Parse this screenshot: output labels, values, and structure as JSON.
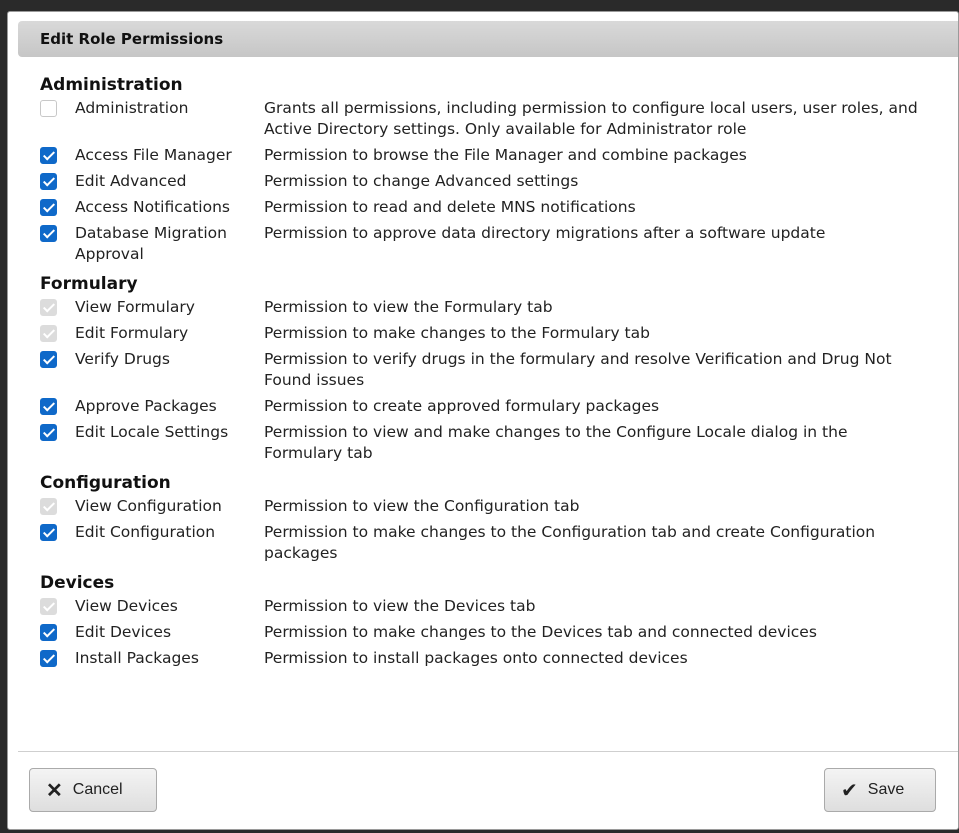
{
  "dialog": {
    "title": "Edit Role Permissions"
  },
  "sections": [
    {
      "title": "Administration",
      "items": [
        {
          "name": "Administration",
          "desc": "Grants all permissions, including permission to configure local users, user roles, and Active Directory settings. Only available for Administrator role",
          "state": "empty"
        },
        {
          "name": "Access File Manager",
          "desc": "Permission to browse the File Manager and combine packages",
          "state": "checked"
        },
        {
          "name": "Edit Advanced",
          "desc": "Permission to change Advanced settings",
          "state": "checked"
        },
        {
          "name": "Access Notifications",
          "desc": "Permission to read and delete MNS notifications",
          "state": "checked"
        },
        {
          "name": "Database Migration Approval",
          "desc": "Permission to approve data directory migrations after a software update",
          "state": "checked"
        }
      ]
    },
    {
      "title": "Formulary",
      "items": [
        {
          "name": "View Formulary",
          "desc": "Permission to view the Formulary tab",
          "state": "disabled"
        },
        {
          "name": "Edit Formulary",
          "desc": "Permission to make changes to the Formulary tab",
          "state": "disabled"
        },
        {
          "name": "Verify Drugs",
          "desc": "Permission to verify drugs in the formulary and resolve Verification and Drug Not Found issues",
          "state": "checked"
        },
        {
          "name": "Approve Packages",
          "desc": "Permission to create approved formulary packages",
          "state": "checked"
        },
        {
          "name": "Edit Locale Settings",
          "desc": "Permission to view and make changes to the Configure Locale dialog in the Formulary tab",
          "state": "checked"
        }
      ]
    },
    {
      "title": "Configuration",
      "items": [
        {
          "name": "View Configuration",
          "desc": "Permission to view the Configuration tab",
          "state": "disabled"
        },
        {
          "name": "Edit Configuration",
          "desc": "Permission to make changes to the Configuration tab and create Configuration packages",
          "state": "checked"
        }
      ]
    },
    {
      "title": "Devices",
      "items": [
        {
          "name": "View Devices",
          "desc": "Permission to view the Devices tab",
          "state": "disabled"
        },
        {
          "name": "Edit Devices",
          "desc": "Permission to make changes to the Devices tab and connected devices",
          "state": "checked"
        },
        {
          "name": "Install Packages",
          "desc": "Permission to install packages onto connected devices",
          "state": "checked"
        }
      ]
    }
  ],
  "buttons": {
    "cancel_label": "Cancel",
    "cancel_icon": "close-icon",
    "save_label": "Save",
    "save_icon": "check-icon"
  },
  "colors": {
    "checkbox_checked": "#0f69c9",
    "checkbox_disabled": "#dcdcdc"
  }
}
